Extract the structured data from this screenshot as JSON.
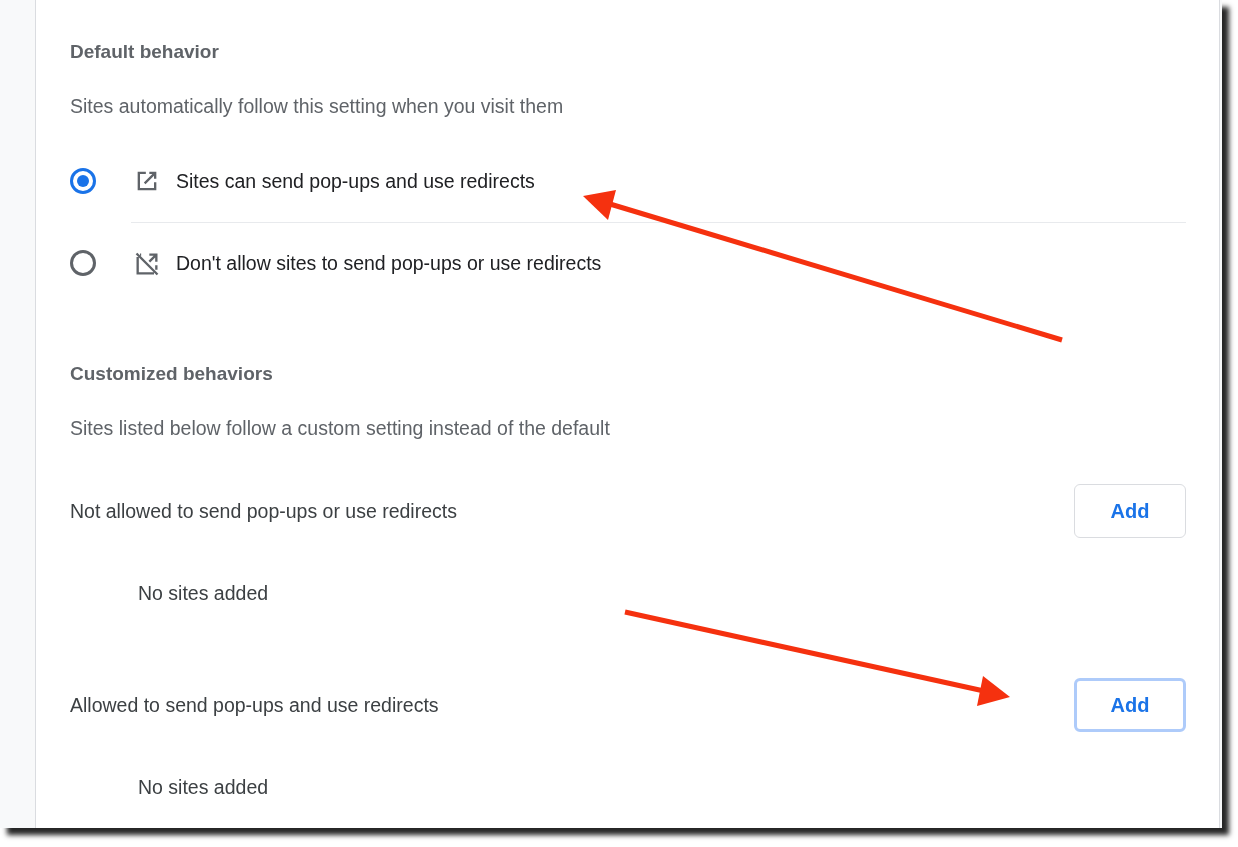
{
  "default_behavior": {
    "heading": "Default behavior",
    "description": "Sites automatically follow this setting when you visit them",
    "options": [
      {
        "kind": "allow",
        "label": "Sites can send pop-ups and use redirects",
        "selected": true
      },
      {
        "kind": "block",
        "label": "Don't allow sites to send pop-ups or use redirects",
        "selected": false
      }
    ]
  },
  "customized_behaviors": {
    "heading": "Customized behaviors",
    "description": "Sites listed below follow a custom setting instead of the default",
    "lists": [
      {
        "label": "Not allowed to send pop-ups or use redirects",
        "button": {
          "label": "Add",
          "focused": false
        },
        "empty_text": "No sites added"
      },
      {
        "label": "Allowed to send pop-ups and use redirects",
        "button": {
          "label": "Add",
          "focused": true
        },
        "empty_text": "No sites added"
      }
    ]
  }
}
